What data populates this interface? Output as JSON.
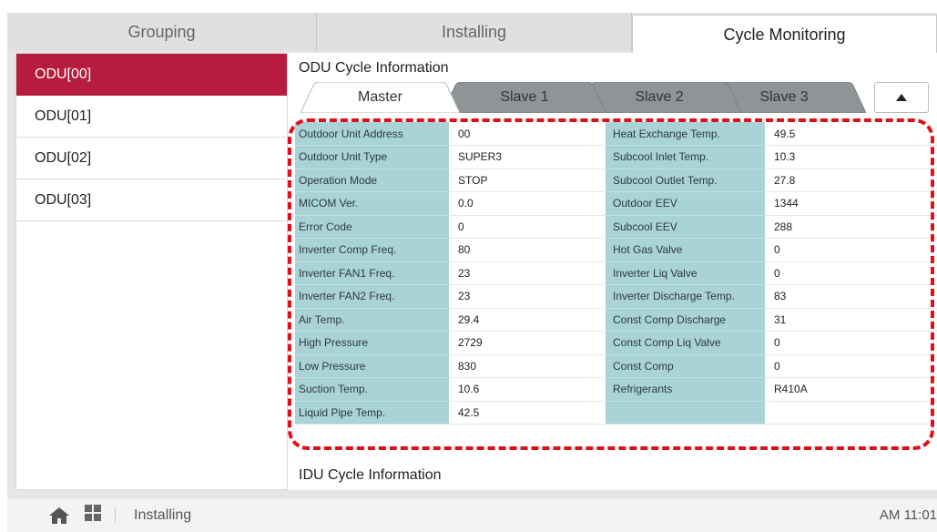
{
  "top_tabs": [
    "Grouping",
    "Installing",
    "Cycle Monitoring"
  ],
  "odu_list": [
    {
      "label": "ODU[00]",
      "selected": true
    },
    {
      "label": "ODU[01]",
      "selected": false
    },
    {
      "label": "ODU[02]",
      "selected": false
    },
    {
      "label": "ODU[03]",
      "selected": false
    }
  ],
  "panel": {
    "title": "ODU Cycle Information",
    "sub_tabs": [
      "Master",
      "Slave 1",
      "Slave 2",
      "Slave 3"
    ],
    "scroll_up_icon": "triangle-up-icon",
    "rows": [
      {
        "l1": "Outdoor Unit Address",
        "v1": "00",
        "l2": "Heat Exchange Temp.",
        "v2": "49.5"
      },
      {
        "l1": "Outdoor Unit Type",
        "v1": "SUPER3",
        "l2": "Subcool Inlet Temp.",
        "v2": "10.3"
      },
      {
        "l1": "Operation Mode",
        "v1": "STOP",
        "l2": "Subcool Outlet Temp.",
        "v2": "27.8"
      },
      {
        "l1": "MICOM Ver.",
        "v1": "0.0",
        "l2": "Outdoor EEV",
        "v2": "1344"
      },
      {
        "l1": "Error Code",
        "v1": "0",
        "l2": "Subcool EEV",
        "v2": "288"
      },
      {
        "l1": "Inverter Comp Freq.",
        "v1": "80",
        "l2": "Hot Gas Valve",
        "v2": "0"
      },
      {
        "l1": "Inverter FAN1 Freq.",
        "v1": "23",
        "l2": "Inverter Liq Valve",
        "v2": "0"
      },
      {
        "l1": "Inverter FAN2 Freq.",
        "v1": "23",
        "l2": "Inverter Discharge Temp.",
        "v2": "83"
      },
      {
        "l1": "Air Temp.",
        "v1": "29.4",
        "l2": "Const Comp Discharge",
        "v2": "31"
      },
      {
        "l1": "High Pressure",
        "v1": "2729",
        "l2": "Const Comp Liq Valve",
        "v2": "0"
      },
      {
        "l1": "Low Pressure",
        "v1": "830",
        "l2": "Const Comp",
        "v2": "0"
      },
      {
        "l1": "Suction Temp.",
        "v1": "10.6",
        "l2": "Refrigerants",
        "v2": "R410A"
      },
      {
        "l1": "Liquid Pipe Temp.",
        "v1": "42.5",
        "l2": "",
        "v2": ""
      }
    ],
    "idu_title": "IDU Cycle Information"
  },
  "bottom_bar": {
    "home_icon": "home-icon",
    "menu_icon": "grid-icon",
    "label": "Installing",
    "time": "AM 11:01"
  },
  "colors": {
    "selected": "#b51c3e",
    "label_cell": "#a9d3d6",
    "highlight": "#e0101a"
  }
}
